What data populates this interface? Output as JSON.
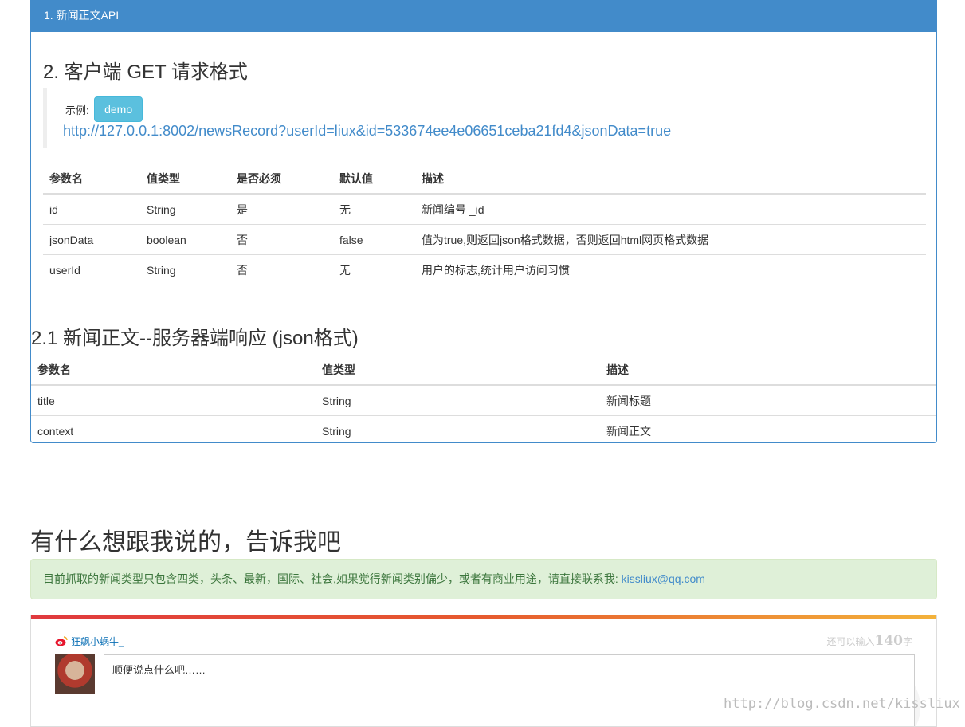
{
  "panel": {
    "heading": "1. 新闻正文API",
    "request_title": "2. 客户端 GET 请求格式",
    "example_label": "示例:",
    "demo_button": "demo",
    "example_url": "http://127.0.0.1:8002/newsRecord?userId=liux&id=533674ee4e06651ceba21fd4&jsonData=true",
    "params_table": {
      "headers": [
        "参数名",
        "值类型",
        "是否必须",
        "默认值",
        "描述"
      ],
      "rows": [
        [
          "id",
          "String",
          "是",
          "无",
          "新闻编号 _id"
        ],
        [
          "jsonData",
          "boolean",
          "否",
          "false",
          "值为true,则返回json格式数据，否则返回html网页格式数据"
        ],
        [
          "userId",
          "String",
          "否",
          "无",
          "用户的标志,统计用户访问习惯"
        ]
      ]
    },
    "response_title": "2.1 新闻正文--服务器端响应 (json格式)",
    "response_table": {
      "headers": [
        "参数名",
        "值类型",
        "描述"
      ],
      "rows": [
        [
          "title",
          "String",
          "新闻标题"
        ],
        [
          "context",
          "String",
          "新闻正文"
        ]
      ]
    }
  },
  "feedback": {
    "title": "有什么想跟我说的，告诉我吧",
    "alert_text": "目前抓取的新闻类型只包含四类，头条、最新，国际、社会,如果觉得新闻类别偏少，或者有商业用途，请直接联系我: ",
    "email": "kissliux@qq.com"
  },
  "weibo": {
    "username": "狂飙小蜗牛_",
    "count_prefix": "还可以输入",
    "count_value": "140",
    "count_suffix": "字",
    "placeholder": "顺便说点什么吧……",
    "logo_icon": "weibo-logo-icon"
  },
  "watermark": "http://blog.csdn.net/kissliux"
}
